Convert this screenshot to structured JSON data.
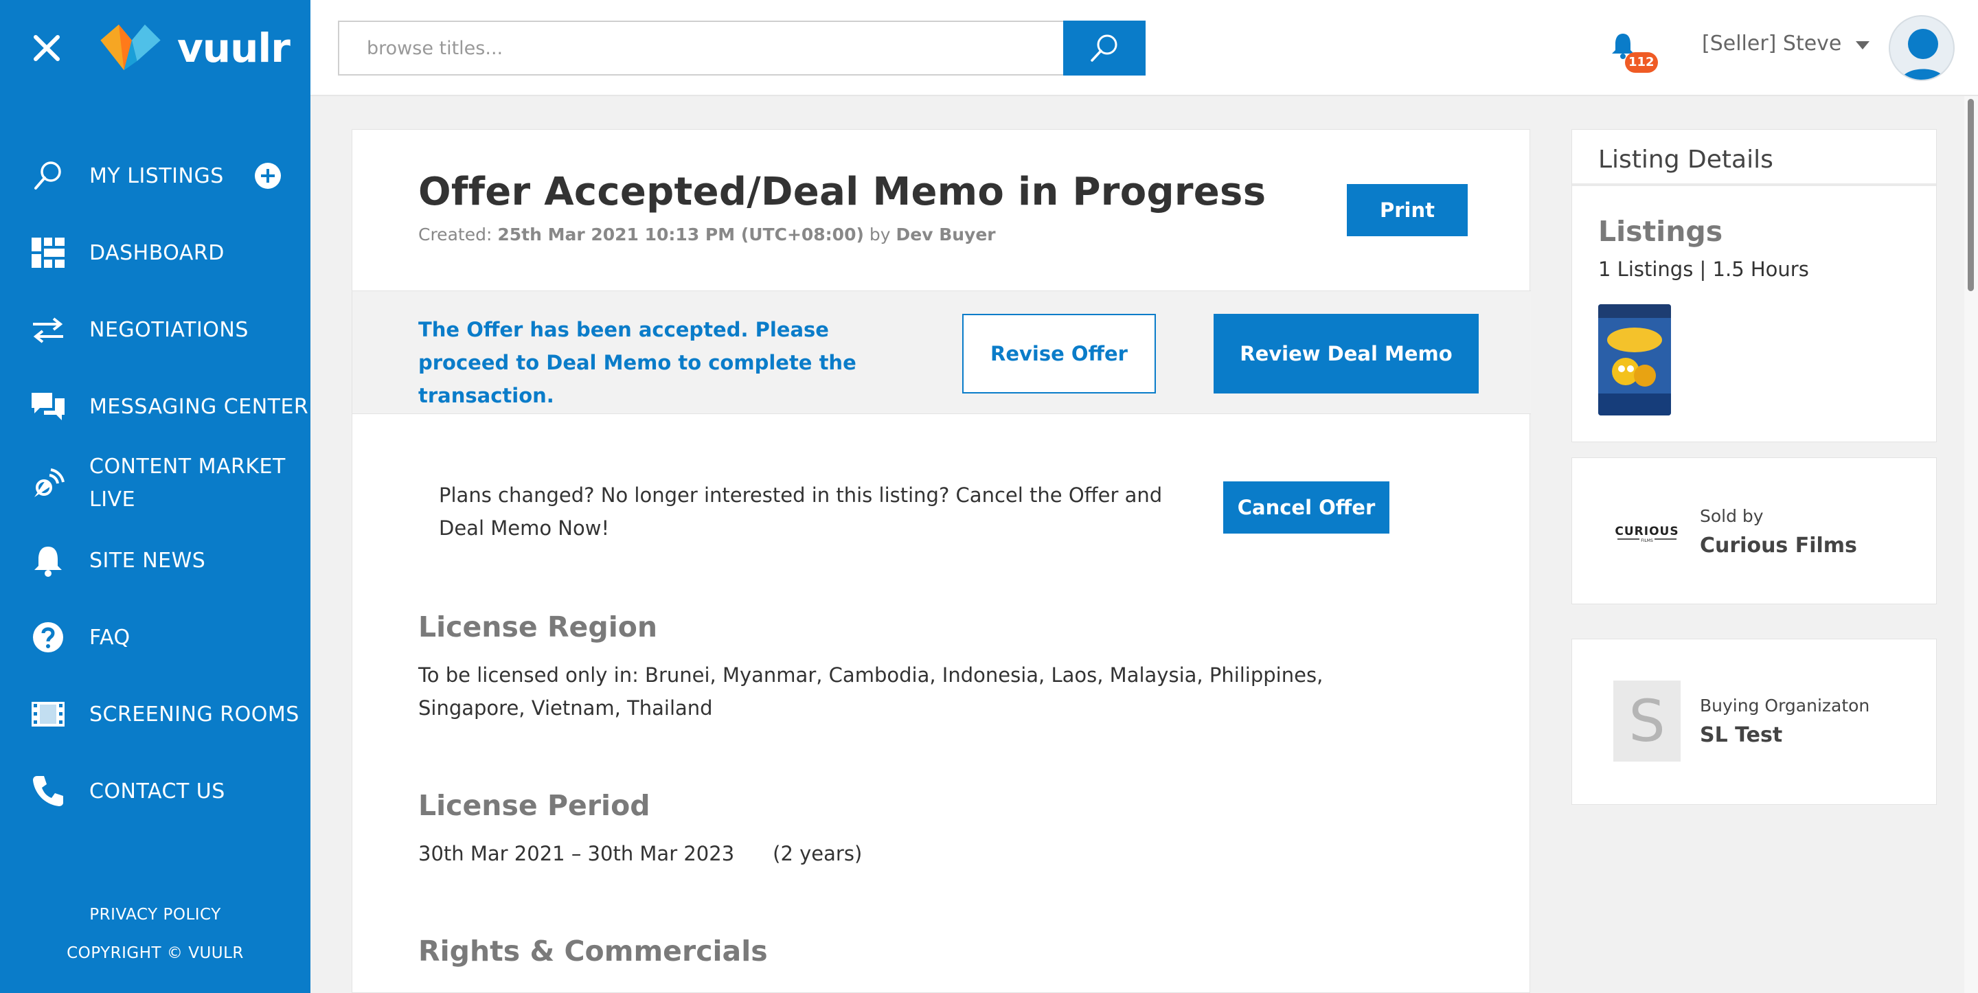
{
  "brand": {
    "name": "vuulr",
    "blue": "#0a7cc9",
    "accent_orange": "#ef5b25"
  },
  "sidebar": {
    "items": [
      {
        "label": "MY LISTINGS",
        "icon": "search-icon"
      },
      {
        "label": "DASHBOARD",
        "icon": "dashboard-icon"
      },
      {
        "label": "NEGOTIATIONS",
        "icon": "arrows-icon"
      },
      {
        "label": "MESSAGING CENTER",
        "icon": "chat-icon"
      },
      {
        "label": "CONTENT MARKET LIVE",
        "icon": "broadcast-icon"
      },
      {
        "label": "SITE NEWS",
        "icon": "bell-icon"
      },
      {
        "label": "FAQ",
        "icon": "question-icon"
      },
      {
        "label": "SCREENING ROOMS",
        "icon": "film-icon"
      },
      {
        "label": "CONTACT US",
        "icon": "phone-icon"
      }
    ],
    "footer": {
      "privacy": "PRIVACY POLICY",
      "copyright": "COPYRIGHT © VUULR"
    }
  },
  "header": {
    "search_placeholder": "browse titles...",
    "notification_count": "112",
    "user_label": "[Seller] Steve"
  },
  "offer": {
    "title": "Offer Accepted/Deal Memo in Progress",
    "created_label": "Created:",
    "created_date": "25th Mar 2021 10:13 PM (UTC+08:00)",
    "by_label": "by",
    "created_by": "Dev Buyer",
    "print_label": "Print",
    "accepted_message": "The Offer has been accepted. Please proceed to Deal Memo to complete the transaction.",
    "revise_label": "Revise Offer",
    "review_label": "Review Deal Memo",
    "cancel_prompt": "Plans changed? No longer interested in this listing? Cancel the Offer and Deal Memo Now!",
    "cancel_label": "Cancel Offer",
    "region_heading": "License Region",
    "region_text": "To be licensed only in: Brunei, Myanmar, Cambodia, Indonesia, Laos, Malaysia, Philippines, Singapore, Vietnam, Thailand",
    "period_heading": "License Period",
    "period_range": "30th Mar 2021 – 30th Mar 2023",
    "period_duration": "(2 years)",
    "rights_heading": "Rights & Commercials"
  },
  "listing_details": {
    "heading": "Listing Details",
    "listings_heading": "Listings",
    "listings_summary": "1 Listings | 1.5 Hours",
    "seller_label": "Sold by",
    "seller_name": "Curious Films",
    "seller_logo_text": "CURIOUS",
    "seller_logo_sub": "FILMS",
    "buyer_label": "Buying Organizaton",
    "buyer_name": "SL Test",
    "buyer_initial": "S"
  }
}
